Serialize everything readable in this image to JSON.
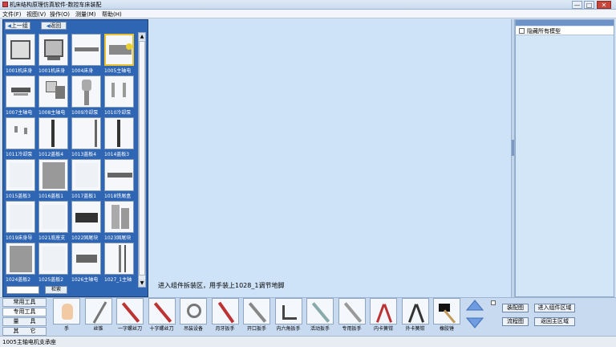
{
  "window": {
    "title": "机床结构原理仿真软件-数控车床装配",
    "minimize": "—",
    "maximize": "□",
    "close": "✕"
  },
  "menu": [
    "文件(F)",
    "视图(V)",
    "操作(O)",
    "测量(M)",
    "帮助(H)"
  ],
  "left_panel": {
    "prev_label": "上一组",
    "back_label": "返回",
    "search_value": "",
    "search_button": "检索",
    "thumbnails": [
      {
        "label": "1001机床身",
        "icon": "bed-plate",
        "selected": false
      },
      {
        "label": "1001机床身",
        "icon": "bed-frame",
        "selected": false
      },
      {
        "label": "1004床身",
        "icon": "rail",
        "selected": false
      },
      {
        "label": "1005主轴电",
        "icon": "motor-mount",
        "selected": true
      },
      {
        "label": "1007主轴电",
        "icon": "motor",
        "selected": false
      },
      {
        "label": "1008主轴电",
        "icon": "motor-block",
        "selected": false
      },
      {
        "label": "1009冷却泵",
        "icon": "pump",
        "selected": false
      },
      {
        "label": "1010冷却泵",
        "icon": "pump-parts",
        "selected": false
      },
      {
        "label": "1011冷却泵",
        "icon": "pump-small",
        "selected": false
      },
      {
        "label": "1012盖板4",
        "icon": "panel-bar",
        "selected": false
      },
      {
        "label": "1013盖板4",
        "icon": "panel-edge",
        "selected": false
      },
      {
        "label": "1014盖板3",
        "icon": "panel-bar",
        "selected": false
      },
      {
        "label": "1015盖板3",
        "icon": "panel-flat",
        "selected": false
      },
      {
        "label": "1016盖板1",
        "icon": "panel-grey",
        "selected": false
      },
      {
        "label": "1017盖板1",
        "icon": "panel-flat",
        "selected": false
      },
      {
        "label": "1018铁屑盒",
        "icon": "tray",
        "selected": false
      },
      {
        "label": "1019床身导",
        "icon": "panel-flat",
        "selected": false
      },
      {
        "label": "1021底座支",
        "icon": "panel-flat",
        "selected": false
      },
      {
        "label": "1022固尾块",
        "icon": "block-dark",
        "selected": false
      },
      {
        "label": "1023固尾块",
        "icon": "bolts",
        "selected": false
      },
      {
        "label": "1024盖板2",
        "icon": "panel-grey",
        "selected": false
      },
      {
        "label": "1025盖板2",
        "icon": "panel-flat",
        "selected": false
      },
      {
        "label": "1026主轴电",
        "icon": "motor-small",
        "selected": false
      },
      {
        "label": "1027_1主轴",
        "icon": "shaft",
        "selected": false
      }
    ]
  },
  "workspace": {
    "hint": "进入组件拆装区，用手装上1028_1调节地脚"
  },
  "right_panel": {
    "hide_all_label": "隐藏所有模型"
  },
  "bottom_toolbar": {
    "categories": [
      {
        "label": "常用工具",
        "active": false
      },
      {
        "label": "专用工具",
        "active": true
      },
      {
        "label": "量　　具",
        "active": false
      },
      {
        "label": "其　　它",
        "active": false
      }
    ],
    "tools": [
      {
        "label": "手",
        "icon": "hand-icon"
      },
      {
        "label": "丝锥",
        "icon": "tap-icon"
      },
      {
        "label": "一字螺丝刀",
        "icon": "flat-screwdriver-icon"
      },
      {
        "label": "十字螺丝刀",
        "icon": "phillips-screwdriver-icon"
      },
      {
        "label": "吊装设备",
        "icon": "hoist-icon"
      },
      {
        "label": "月牙扳手",
        "icon": "hook-spanner-icon"
      },
      {
        "label": "开口扳手",
        "icon": "open-wrench-icon"
      },
      {
        "label": "内六角扳手",
        "icon": "hex-key-icon"
      },
      {
        "label": "活动扳手",
        "icon": "adjustable-wrench-icon"
      },
      {
        "label": "专用扳手",
        "icon": "special-wrench-icon"
      },
      {
        "label": "内卡簧钳",
        "icon": "internal-circlip-pliers-icon"
      },
      {
        "label": "外卡簧钳",
        "icon": "external-circlip-pliers-icon"
      },
      {
        "label": "橡胶锤",
        "icon": "rubber-mallet-icon"
      }
    ],
    "buttons": {
      "assembly_drawing": "装配图",
      "flow_chart": "流程图",
      "enter_component_area": "进入组件区域",
      "back_main_area": "返回主区域"
    }
  },
  "status": {
    "text": "1005主轴电机支承座"
  },
  "colors": {
    "panel_blue": "#2f66b3",
    "workspace": "#cfe3f8",
    "selected_border": "#e8c230"
  }
}
